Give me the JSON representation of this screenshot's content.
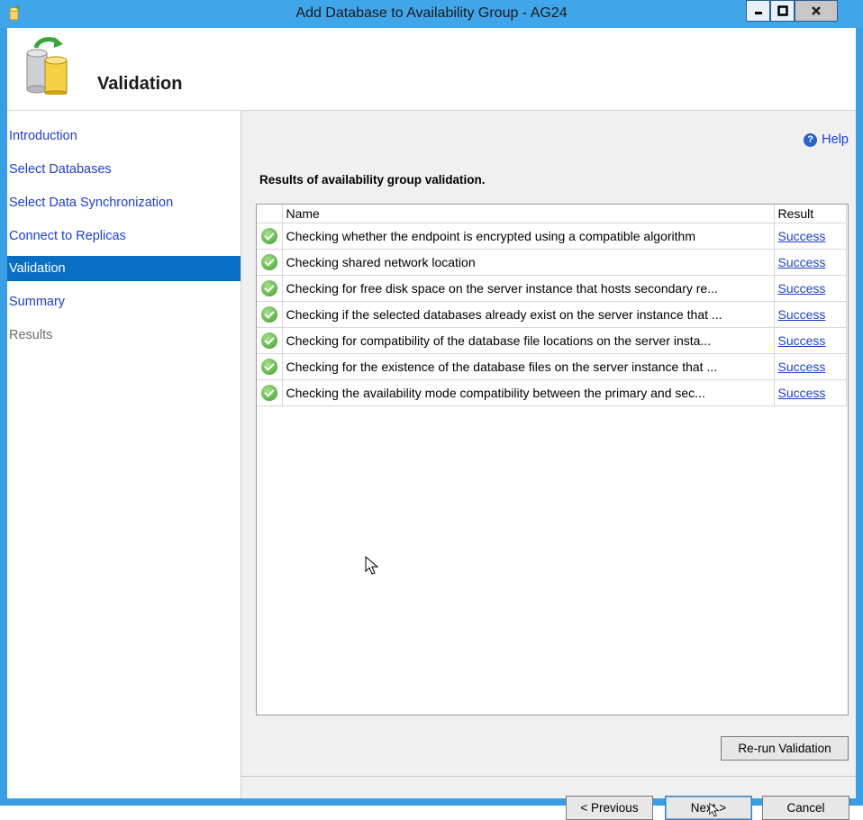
{
  "window": {
    "title": "Add Database to Availability Group - AG24"
  },
  "header": {
    "title": "Validation"
  },
  "nav": {
    "items": [
      {
        "label": "Introduction",
        "state": "link"
      },
      {
        "label": "Select Databases",
        "state": "link"
      },
      {
        "label": "Select Data Synchronization",
        "state": "link"
      },
      {
        "label": "Connect to Replicas",
        "state": "link"
      },
      {
        "label": "Validation",
        "state": "active"
      },
      {
        "label": "Summary",
        "state": "link"
      },
      {
        "label": "Results",
        "state": "disabled"
      }
    ]
  },
  "main": {
    "help_label": "Help",
    "results_label": "Results of availability group validation.",
    "table": {
      "columns": [
        "Name",
        "Result"
      ],
      "rows": [
        {
          "name": "Checking whether the endpoint is encrypted using a compatible algorithm",
          "result": "Success"
        },
        {
          "name": "Checking shared network location",
          "result": "Success"
        },
        {
          "name": "Checking for free disk space on the server instance that hosts secondary re...",
          "result": "Success"
        },
        {
          "name": "Checking if the selected databases already exist on the server instance that ...",
          "result": "Success"
        },
        {
          "name": "Checking for compatibility of the database file locations on the server insta...",
          "result": "Success"
        },
        {
          "name": "Checking for the existence of the database files on the server instance that ...",
          "result": "Success"
        },
        {
          "name": "Checking the availability mode compatibility between the primary and sec...",
          "result": "Success"
        }
      ]
    },
    "rerun_label": "Re-run Validation"
  },
  "footer": {
    "previous_label": "< Previous",
    "next_label": "Next >",
    "cancel_label": "Cancel"
  },
  "colors": {
    "title_bar": "#41a5ea",
    "nav_active": "#0a6fc2",
    "link": "#1c3fd6",
    "success_icon": "#3c9b2a"
  }
}
